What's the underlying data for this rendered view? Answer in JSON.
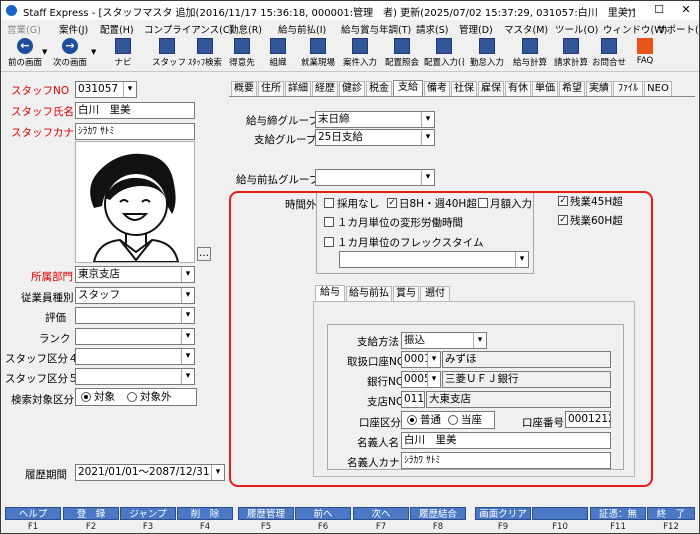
{
  "window": {
    "app": "Staff Express",
    "title": "Staff Express - [スタッフマスタ 追加(2016/11/17 15:36:18, 000001:管理　者) 更新(2025/07/02 15:37:29, 031057:白川　里美)]",
    "minimize": "—",
    "maximize": "☐",
    "close": "✕"
  },
  "menu": [
    "営業(G)",
    "案件(J)",
    "配置(H)",
    "コンプライアンス(C)",
    "勤怠(R)",
    "給与前払(I)",
    "給与賞与年調(T)",
    "請求(S)",
    "管理(D)",
    "マスタ(M)",
    "ツール(O)",
    "ウィンドウ(W)",
    "サポート(H)"
  ],
  "toolbar": {
    "prev_screen": "前の画面",
    "next_screen": "次の画面",
    "buttons": [
      "ナビ",
      "スタッフ",
      "ｽﾀｯﾌ検索",
      "得意先",
      "組織",
      "就業現場",
      "案件入力",
      "配置照会",
      "配置入力(日",
      "勤怠入力",
      "給与計算",
      "請求計算",
      "お問合せ",
      "FAQ"
    ]
  },
  "left": {
    "staff_no_label": "スタッフNO",
    "staff_no": "031057",
    "name_label": "スタッフ氏名",
    "name": "白川　里美",
    "kana_label": "スタッフカナ",
    "kana": "ｼﾗｶﾜ ｻﾄﾐ",
    "photo_button": "...",
    "dept_label": "所属部門",
    "dept": "東京支店",
    "emp_type_label": "従業員種別",
    "emp_type": "スタッフ",
    "rating_label": "評価",
    "rating": "",
    "rank_label": "ランク",
    "rank": "",
    "cat4_label": "スタッフ区分４",
    "cat4": "",
    "cat5_label": "スタッフ区分５",
    "cat5": "",
    "search_label": "検索対象区分",
    "search_target": "対象",
    "search_excluded": "対象外",
    "history_label": "履歴期間",
    "history_period": "2021/01/01～2087/12/31"
  },
  "tabs": [
    "概要",
    "住所",
    "詳細",
    "経歴",
    "健診",
    "税金",
    "支給",
    "備考",
    "社保",
    "雇保",
    "有休",
    "単価",
    "希望",
    "実績",
    "ﾌｧｲﾙ",
    "NEO"
  ],
  "active_tab": "支給",
  "pay": {
    "pay_group_label": "給与締グループ",
    "pay_group": "末日締",
    "pay_date_group_label": "支給グループ",
    "pay_date_group": "25日支給",
    "advance_group_label": "給与前払グループ",
    "advance_group": ""
  },
  "overtime": {
    "label": "時間外",
    "none": "採用なし",
    "daily8": "日8H・週40H超",
    "monthly": "月額入力",
    "over45": "残業45H超",
    "over60": "残業60H超",
    "variable": "１カ月単位の変形労働時間",
    "flex": "１カ月単位のフレックスタイム"
  },
  "inner_tabs": [
    "給与",
    "給与前払",
    "賞与",
    "遡付"
  ],
  "active_inner_tab": "給与",
  "bank": {
    "method_label": "支給方法",
    "method": "振込",
    "bank_label": "取扱口座NO",
    "bank_code": "0001",
    "bank_name": "みずほ",
    "bank2_label": "銀行NO",
    "bank2_code": "0005",
    "bank2_name": "三菱ＵＦＪ銀行",
    "branch_label": "支店NO",
    "branch_code": "011",
    "branch_name": "大東支店",
    "acct_type_label": "口座区分",
    "acct_normal": "普通",
    "acct_current": "当座",
    "acct_no_label": "口座番号",
    "acct_no": "0001212",
    "holder_label": "名義人名",
    "holder": "白川　里美",
    "holder_kana_label": "名義人カナ",
    "holder_kana": "ｼﾗｶﾜ ｻﾄﾐ"
  },
  "fkeys": [
    {
      "label": "ヘルプ",
      "key": "F1"
    },
    {
      "label": "登　録",
      "key": "F2"
    },
    {
      "label": "ジャンプ",
      "key": "F3"
    },
    {
      "label": "削　除",
      "key": "F4"
    },
    {
      "label": "履歴管理",
      "key": "F5"
    },
    {
      "label": "前へ",
      "key": "F6"
    },
    {
      "label": "次へ",
      "key": "F7"
    },
    {
      "label": "履歴結合",
      "key": "F8"
    },
    {
      "label": "画面クリア",
      "key": "F9"
    },
    {
      "label": "",
      "key": "F10"
    },
    {
      "label": "証憑：無",
      "key": "F11"
    },
    {
      "label": "終　了",
      "key": "F12"
    }
  ],
  "colors": {
    "accent": "#1d4f9c",
    "fkey": "#4b78c5",
    "required_label": "#e00000",
    "highlight": "#e61c1c"
  }
}
